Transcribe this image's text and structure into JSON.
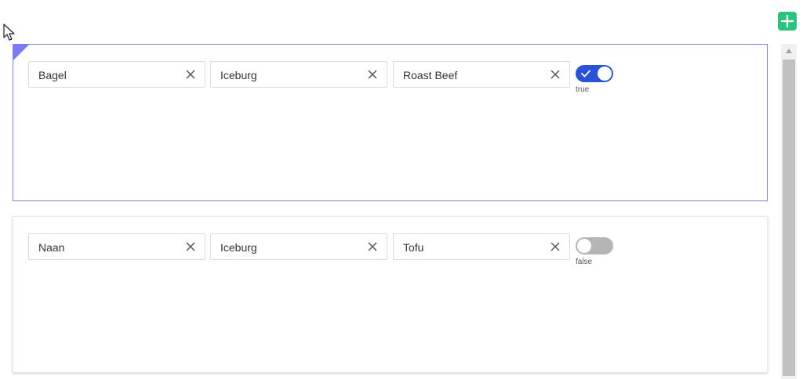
{
  "icons": {
    "cursor": "arrow-cursor-icon",
    "add": "plus-icon",
    "clear": "close-icon",
    "check": "check-icon"
  },
  "colors": {
    "accent": "#7b7cf0",
    "toggle_on": "#2a52d8",
    "toggle_off": "#b5b5b5",
    "add_button": "#2bc37f"
  },
  "rows": [
    {
      "selected": true,
      "fields": [
        "Bagel",
        "Iceburg",
        "Roast Beef"
      ],
      "toggle_on": true,
      "toggle_label": "true"
    },
    {
      "selected": false,
      "fields": [
        "Naan",
        "Iceburg",
        "Tofu"
      ],
      "toggle_on": false,
      "toggle_label": "false"
    }
  ]
}
